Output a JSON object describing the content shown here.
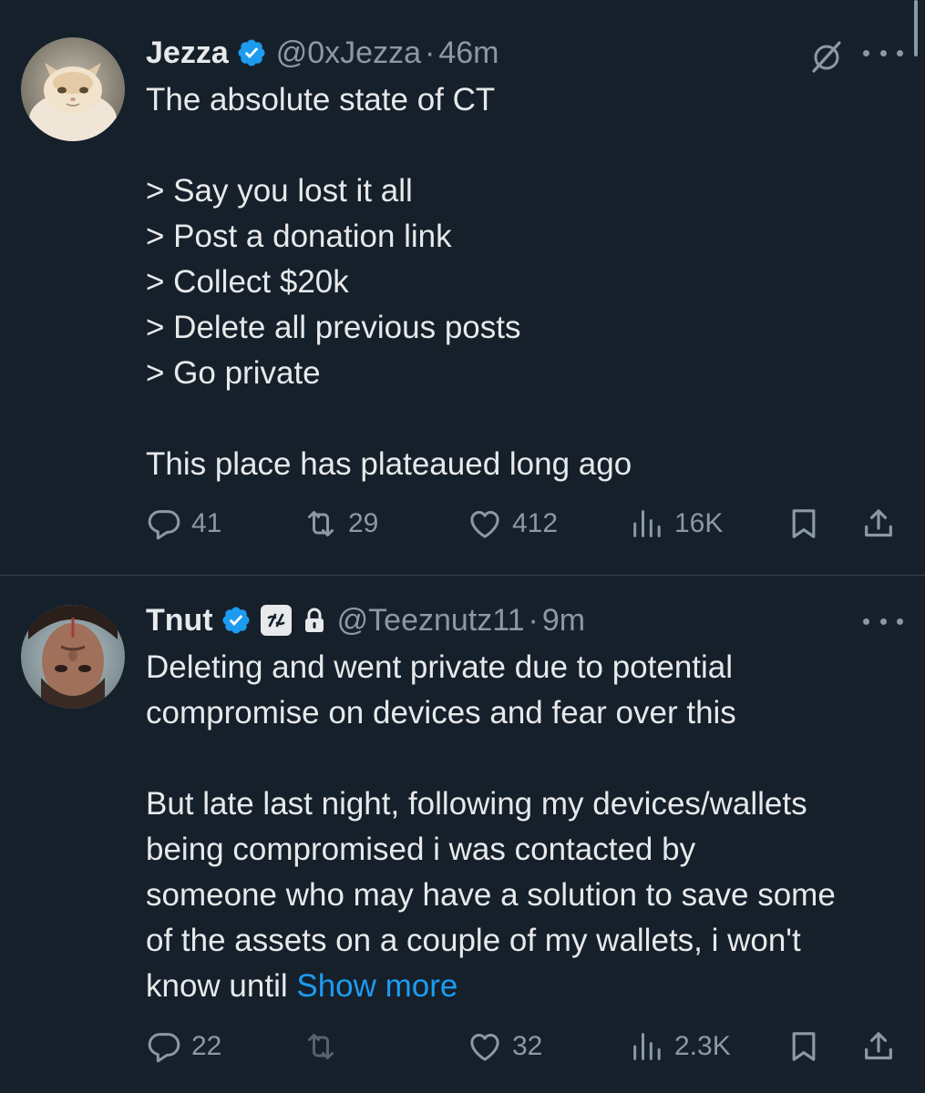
{
  "tweets": [
    {
      "name": "Jezza",
      "handle": "@0xJezza",
      "dot": "·",
      "time": "46m",
      "lines_a": [
        "The absolute state of CT"
      ],
      "lines_b": [
        "> Say you lost it all",
        "> Post a donation link",
        "> Collect $20k",
        "> Delete all previous posts",
        "> Go private"
      ],
      "lines_c": [
        "This place has plateaued long ago"
      ],
      "replies": "41",
      "retweets": "29",
      "likes": "412",
      "views": "16K",
      "avatar_icon": "cat-avatar",
      "grok_icon": "grok-icon"
    },
    {
      "name": "Tnut",
      "handle": "@Teeznutz11",
      "dot": "·",
      "time": "9m",
      "lines_a": [
        "Deleting and went private due to potential",
        "compromise on devices and fear over this"
      ],
      "lines_b": [
        "But late last night, following my devices/wallets",
        "being compromised i was contacted by",
        "someone who may have a solution to save some",
        "of the assets on a couple of my wallets, i won't"
      ],
      "last_line_prefix": "know until ",
      "show_more": "Show more",
      "replies": "22",
      "retweets": "",
      "likes": "32",
      "views": "2.3K",
      "avatar_icon": "person-avatar",
      "affiliate_badge_icon": "affiliate-badge-icon",
      "lock_icon": "lock-icon"
    }
  ],
  "colors": {
    "background": "#15202b",
    "text": "#e7e9ea",
    "muted": "#8b98a5",
    "accent": "#1d9bf0",
    "divider": "#38444d"
  }
}
